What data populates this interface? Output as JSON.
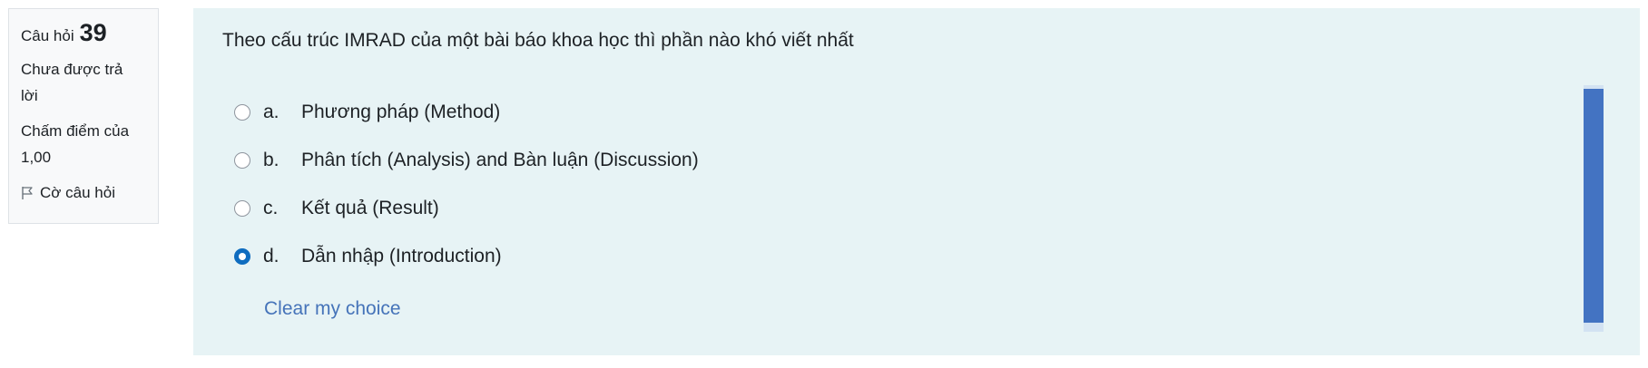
{
  "info": {
    "question_label": "Câu hỏi",
    "question_number": "39",
    "state_line1": "Chưa được trả",
    "state_line2": "lời",
    "grade_line1": "Chấm điểm của",
    "grade_line2": "1,00",
    "flag_label": "Cờ câu hỏi",
    "flag_icon": "flag-icon"
  },
  "question": {
    "text": "Theo cấu trúc IMRAD của một bài báo khoa học thì phần nào khó viết nhất",
    "options": [
      {
        "letter": "a.",
        "text": "Phương pháp (Method)",
        "selected": false
      },
      {
        "letter": "b.",
        "text": "Phân tích (Analysis) and Bàn luận (Discussion)",
        "selected": false
      },
      {
        "letter": "c.",
        "text": "Kết quả (Result)",
        "selected": false
      },
      {
        "letter": "d.",
        "text": "Dẫn nhập (Introduction)",
        "selected": true
      }
    ],
    "clear_label": "Clear my choice"
  },
  "colors": {
    "content_bg": "#e7f3f5",
    "accent": "#0f6cbf",
    "link": "#4573b9",
    "scrollbar": "#4373c2"
  }
}
